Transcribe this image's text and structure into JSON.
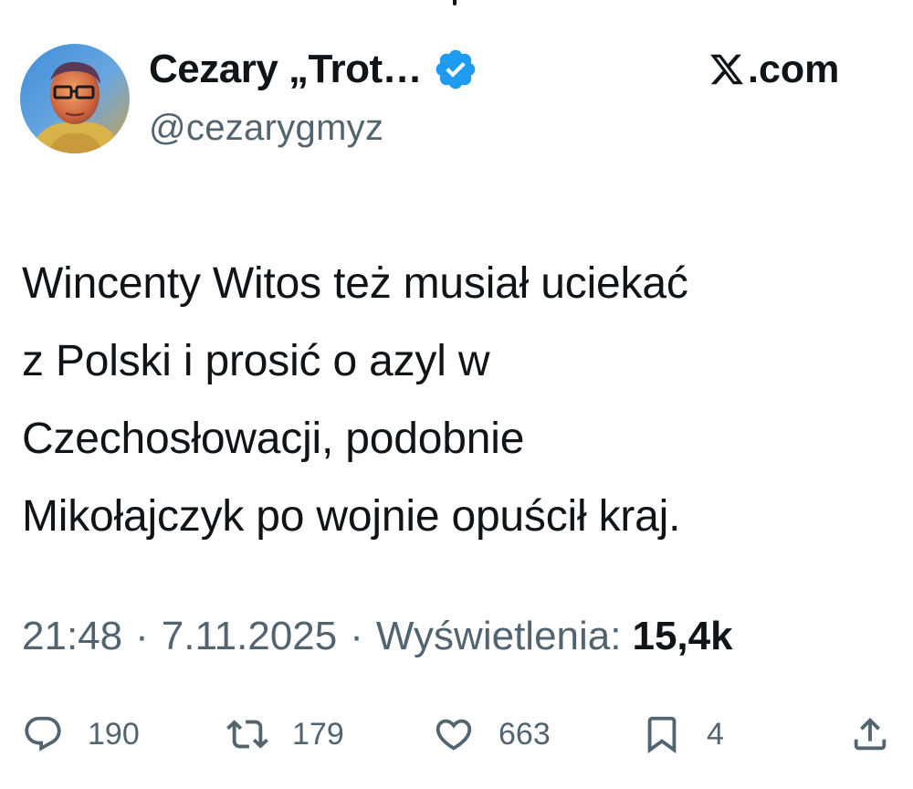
{
  "author": {
    "display_name": "Cezary „Trot…",
    "handle": "@cezarygmyz",
    "verified": true,
    "verified_color": "#1d9bf0"
  },
  "brand": {
    "label": ".com",
    "icon": "x-logo-icon"
  },
  "tweet": {
    "lines": [
      "Wincenty Witos też musiał uciekać",
      "z Polski i prosić o azyl w",
      "Czechosłowacji, podobnie",
      "Mikołajczyk po wojnie opuścił kraj."
    ]
  },
  "meta": {
    "time": "21:48",
    "separator": "·",
    "date": "7.11.2025",
    "views_label": "Wyświetlenia:",
    "views_count": "15,4k"
  },
  "actions": [
    {
      "icon": "reply-icon",
      "count": "190"
    },
    {
      "icon": "retweet-icon",
      "count": "179"
    },
    {
      "icon": "like-icon",
      "count": "663"
    },
    {
      "icon": "bookmark-icon",
      "count": "4"
    },
    {
      "icon": "share-icon",
      "count": ""
    }
  ],
  "colors": {
    "text_primary": "#0f1419",
    "text_secondary": "#536471",
    "accent": "#1d9bf0"
  }
}
